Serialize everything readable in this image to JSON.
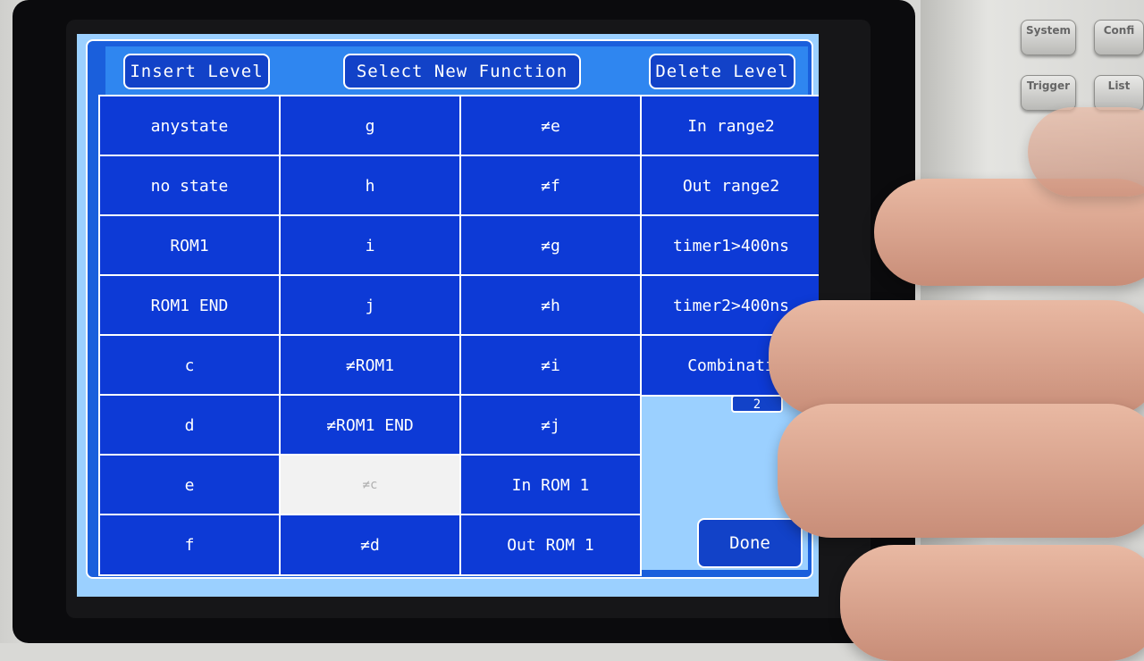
{
  "dialog": {
    "insert_level": "Insert Level",
    "select_new_function": "Select New Function",
    "delete_level": "Delete Level",
    "done": "Done",
    "hint_value": "2"
  },
  "grid": {
    "col1": [
      "anystate",
      "no state",
      "ROM1",
      "ROM1 END",
      "c",
      "d",
      "e",
      "f"
    ],
    "col2": [
      "g",
      "h",
      "i",
      "j",
      "≠ROM1",
      "≠ROM1 END",
      "≠c",
      "≠d"
    ],
    "col3": [
      "≠e",
      "≠f",
      "≠g",
      "≠h",
      "≠i",
      "≠j",
      "In ROM 1",
      "Out ROM 1"
    ],
    "col4": [
      "In range2",
      "Out range2",
      "timer1>400ns",
      "timer2>400ns",
      "Combinati"
    ]
  },
  "hardware": {
    "system": "System",
    "config": "Confi",
    "trigger": "Trigger",
    "list": "List"
  },
  "colors": {
    "cell_blue": "#0d3ad6",
    "header_blue": "#2f86f0",
    "screen_light": "#9bd0ff"
  }
}
